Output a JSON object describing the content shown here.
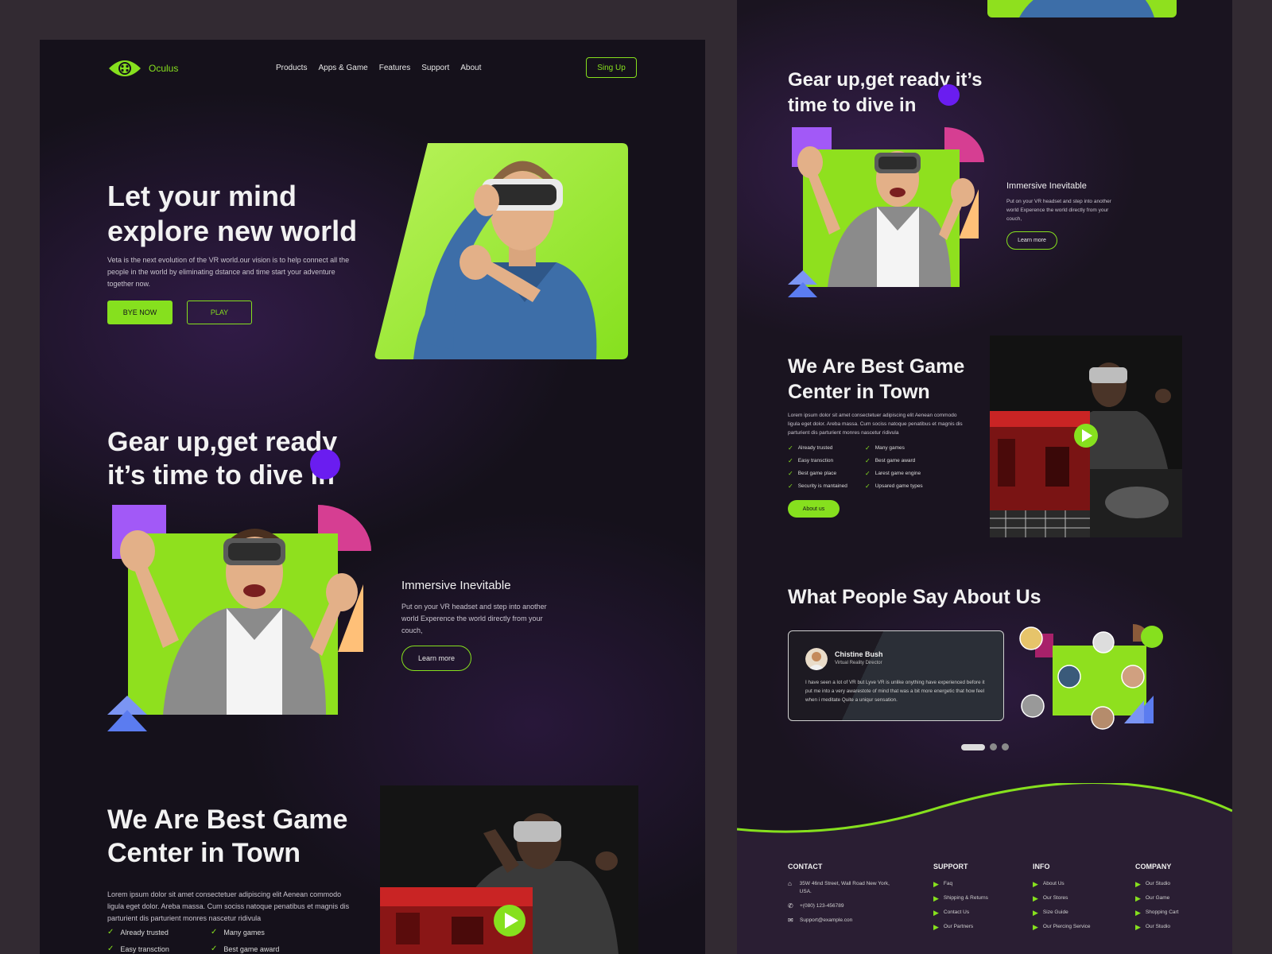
{
  "brand": {
    "name": "Oculus",
    "accent": "#86e01e",
    "purple": "#6a1df0"
  },
  "nav": {
    "links": [
      "Products",
      "Apps & Game",
      "Features",
      "Support",
      "About"
    ],
    "signup": "Sing Up"
  },
  "hero": {
    "title": "Let your mind explore new world",
    "desc": "Veta is the next evolution of the VR world.our vision is to help connect all the people in the world by eliminating dstance and time start your adventure together now.",
    "primary": "BYE NOW",
    "secondary": "PLAY"
  },
  "gear": {
    "title": "Gear up,get ready it’s time to dive in",
    "subtitle": "Immersive Inevitable",
    "desc": "Put on your VR headset and step into another world Experence the world directly from your couch,",
    "cta": "Learn more"
  },
  "best": {
    "title": "We Are Best Game Center in Town",
    "desc": "Lorem ipsum dolor sit amet consectetuer adipiscing elit Aenean commodo ligula eget dolor. Areba massa. Cum sociss natoque penatibus et magnis dis parturient dis parturient monres nascetur ridivula",
    "features": [
      "Already trusted",
      "Many games",
      "Easy transction",
      "Best game award",
      "Best game place",
      "Larest game engine",
      "Security is mantained",
      "Upsared game types"
    ],
    "features_left_visible": [
      "Already trusted",
      "Many games",
      "Easy transction",
      "Best game award"
    ],
    "cta": "About us"
  },
  "testimonials": {
    "title": "What People Say About Us",
    "name": "Chistine Bush",
    "role": "Virtual Reality Director",
    "text": "I have seen a lot of VR but Lyve VR is unlike onything have experienced before it put me into a very awarestote of mind that was a bit more energetic that how feel when i meditate Quite a uniqur sensation."
  },
  "footer": {
    "contact": {
      "heading": "CONTACT",
      "address": "35W 46nd Street, Wall Road New York, USA.",
      "phone": "+(080) 123-456789",
      "email": "Support@example.con"
    },
    "support": {
      "heading": "SUPPORT",
      "items": [
        "Faq",
        "Shipping & Returns",
        "Contact Us",
        "Our Partners"
      ]
    },
    "info": {
      "heading": "INFO",
      "items": [
        "About Us",
        "Our Stores",
        "Size Guide",
        "Our Piercing Service"
      ]
    },
    "company": {
      "heading": "COMPANY",
      "items": [
        "Our Studio",
        "Our Game",
        "Shopping Cart",
        "Our Studio"
      ]
    }
  }
}
